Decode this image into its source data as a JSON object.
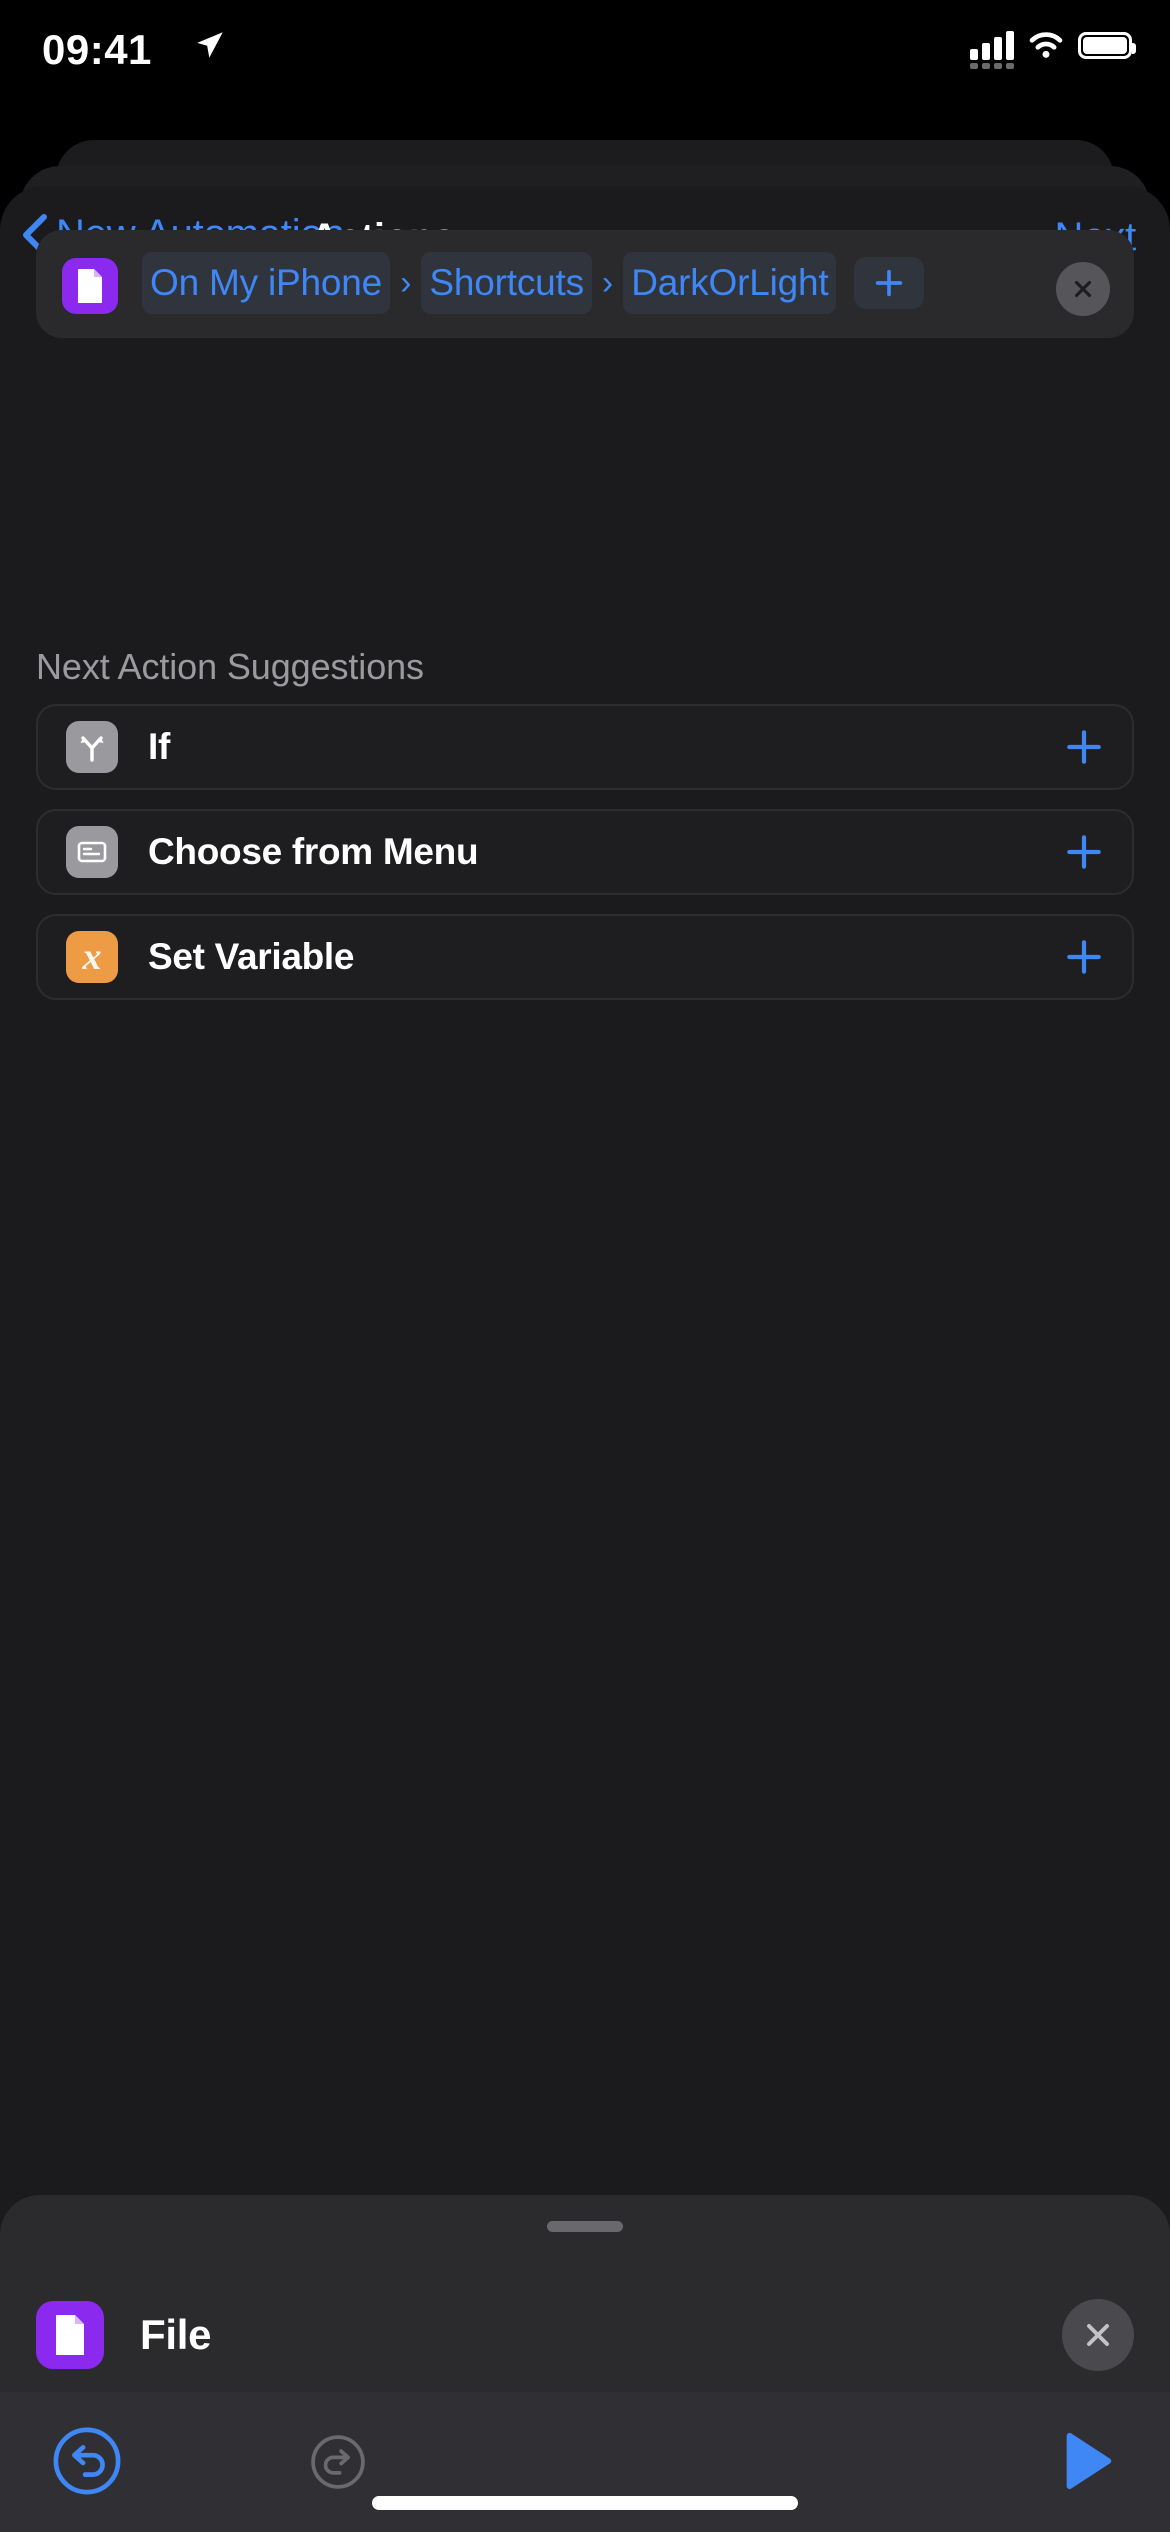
{
  "status_bar": {
    "time": "09:41",
    "location_icon": "location-arrow-icon",
    "signal_icon": "cellular-signal-icon",
    "wifi_icon": "wifi-icon",
    "battery_icon": "battery-full-icon"
  },
  "nav": {
    "back_label": "New Automation",
    "back_icon": "chevron-left-icon",
    "title": "Actions",
    "next_label": "Next"
  },
  "action_card": {
    "app_icon": "file-document-icon",
    "app_icon_color": "#8b2aee",
    "path_tokens": [
      "On My iPhone",
      "Shortcuts",
      "DarkOrLight"
    ],
    "separator": "›",
    "add_icon": "plus-icon",
    "close_icon": "close-x-icon"
  },
  "suggestions": {
    "header": "Next Action Suggestions",
    "items": [
      {
        "label": "If",
        "icon": "branch-arrows-icon",
        "icon_color": "#9a9a9e",
        "add_icon": "plus-icon"
      },
      {
        "label": "Choose from Menu",
        "icon": "menu-list-icon",
        "icon_color": "#9a9a9e",
        "add_icon": "plus-icon"
      },
      {
        "label": "Set Variable",
        "icon": "variable-x-icon",
        "icon_color": "#ee9b46",
        "icon_glyph": "x",
        "add_icon": "plus-icon"
      }
    ]
  },
  "bottom_sheet": {
    "grabber": "drag-handle",
    "icon": "file-document-icon",
    "icon_color": "#8b2aee",
    "label": "File",
    "close_icon": "close-x-icon"
  },
  "toolbar": {
    "undo_icon": "undo-circle-icon",
    "undo_color": "#3f87f5",
    "redo_icon": "redo-circle-icon",
    "redo_color": "#6a6a6e",
    "play_icon": "play-triangle-icon",
    "play_color": "#3f87f5"
  },
  "colors": {
    "accent": "#3f87f5",
    "background": "#1b1b1d",
    "card": "#2a2a2c",
    "token": "#30353d",
    "sheet": "#2b2b2d",
    "toolbar": "#303034"
  }
}
